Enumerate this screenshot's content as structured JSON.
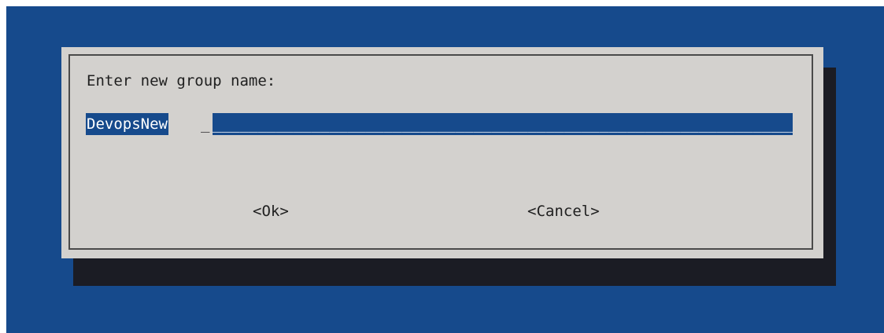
{
  "dialog": {
    "prompt": "Enter new group name:",
    "input": {
      "value": "DevopsNew",
      "cursor": "_",
      "fill": "________________________________________________________________________________"
    },
    "buttons": {
      "ok_label": "<Ok>",
      "cancel_label": "<Cancel>"
    }
  },
  "colors": {
    "background": "#164a8c",
    "dialog": "#d3d1ce",
    "shadow": "#1b1c24",
    "selection": "#164a8c"
  }
}
